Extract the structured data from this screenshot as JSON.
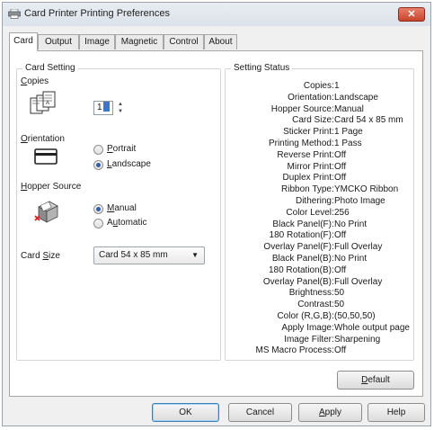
{
  "window": {
    "title": "Card Printer Printing Preferences",
    "close_glyph": "✕"
  },
  "tabs": [
    {
      "label": "Card",
      "active": true
    },
    {
      "label": "Output",
      "active": false
    },
    {
      "label": "Image",
      "active": false
    },
    {
      "label": "Magnetic",
      "active": false
    },
    {
      "label": "Control",
      "active": false
    },
    {
      "label": "About",
      "active": false
    }
  ],
  "card_setting": {
    "title": "Card Setting",
    "copies": {
      "label_first": "C",
      "label_rest": "opies",
      "value": "1",
      "icon": "copies-cards-icon"
    },
    "orientation": {
      "label_first": "O",
      "label_rest": "rientation",
      "icon": "landscape-card-icon",
      "portrait": {
        "first": "P",
        "rest": "ortrait",
        "selected": false
      },
      "landscape": {
        "first": "L",
        "rest": "andscape",
        "selected": true
      }
    },
    "hopper_source": {
      "label_first": "H",
      "label_rest": "opper Source",
      "icon": "card-hopper-icon",
      "manual": {
        "first": "M",
        "rest": "anual",
        "selected": true
      },
      "automatic": {
        "first": "A",
        "mid": "u",
        "rest": "tomatic",
        "selected": false
      }
    },
    "card_size": {
      "label_pre": "Card ",
      "label_acc": "S",
      "label_rest": "ize",
      "value": "Card 54 x 85 mm"
    }
  },
  "setting_status": {
    "title": "Setting Status",
    "items": [
      {
        "key": "Copies",
        "value": "1"
      },
      {
        "key": "Orientation",
        "value": "Landscape"
      },
      {
        "key": "Hopper Source",
        "value": "Manual"
      },
      {
        "key": "Card Size",
        "value": "Card 54 x 85 mm"
      },
      {
        "key": "Sticker Print",
        "value": "1 Page"
      },
      {
        "key": "Printing Method",
        "value": "1 Pass"
      },
      {
        "key": "Reverse Print",
        "value": "Off"
      },
      {
        "key": "Mirror Print",
        "value": "Off"
      },
      {
        "key": "Duplex Print",
        "value": "Off"
      },
      {
        "key": "Ribbon Type",
        "value": "YMCKO Ribbon"
      },
      {
        "key": "Dithering",
        "value": "Photo Image"
      },
      {
        "key": "Color Level",
        "value": "256"
      },
      {
        "key": "Black Panel(F)",
        "value": "No Print"
      },
      {
        "key": "180 Rotation(F)",
        "value": "Off"
      },
      {
        "key": "Overlay Panel(F)",
        "value": "Full Overlay"
      },
      {
        "key": "Black Panel(B)",
        "value": "No Print"
      },
      {
        "key": "180 Rotation(B)",
        "value": "Off"
      },
      {
        "key": "Overlay Panel(B)",
        "value": "Full Overlay"
      },
      {
        "key": "Brightness",
        "value": "50"
      },
      {
        "key": "Contrast",
        "value": "50"
      },
      {
        "key": "Color (R,G,B)",
        "value": "(50,50,50)"
      },
      {
        "key": "Apply Image",
        "value": "Whole output page"
      },
      {
        "key": "Image Filter",
        "value": "Sharpening"
      },
      {
        "key": "MS Macro Process",
        "value": "Off"
      }
    ]
  },
  "buttons": {
    "default": {
      "first": "D",
      "rest": "efault"
    },
    "ok": "OK",
    "cancel": "Cancel",
    "apply": {
      "first": "A",
      "rest": "pply"
    },
    "help": "Help"
  },
  "colors": {
    "accent": "#2f5fa8",
    "close": "#c8442c",
    "window_bg": "#f0f0f0"
  }
}
